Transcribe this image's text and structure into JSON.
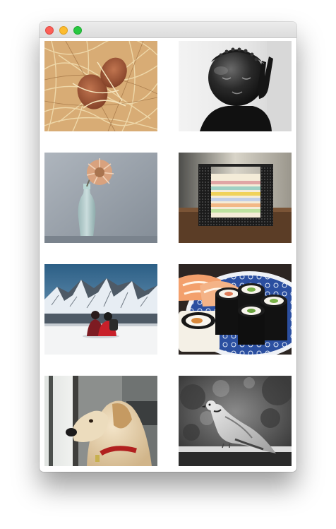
{
  "window": {
    "title": "",
    "controls": [
      "close",
      "minimize",
      "zoom"
    ]
  },
  "gallery": {
    "columns": 2,
    "photos": [
      {
        "subject": "eggs-in-straw-nest-photo"
      },
      {
        "subject": "black-baby-statue-peace-sign-photo"
      },
      {
        "subject": "dried-flower-in-glass-bottle-photo"
      },
      {
        "subject": "sticky-notes-in-mesh-holder-photo"
      },
      {
        "subject": "couple-sitting-before-snowy-mountains-photo"
      },
      {
        "subject": "sushi-rolls-on-plate-photo"
      },
      {
        "subject": "dog-looking-out-window-photo"
      },
      {
        "subject": "dove-on-railing-bw-photo"
      }
    ]
  }
}
